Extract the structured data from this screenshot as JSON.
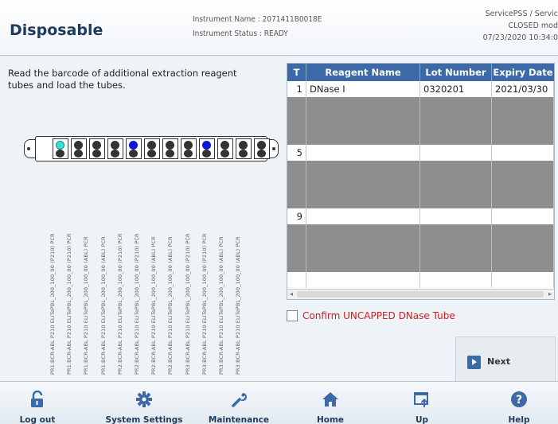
{
  "header": {
    "title": "Disposable",
    "instrument_name": "Instrument Name : 2071411B0018E",
    "instrument_status": "Instrument Status : READY",
    "user": "ServicePSS / Servic",
    "mode": "CLOSED mod",
    "datetime": "07/23/2020 10:34:0"
  },
  "instruction": "Read the barcode of additional extraction reagent tubes and load the tubes.",
  "rack": {
    "slots": [
      "cyan",
      "dark",
      "dark",
      "dark",
      "blue",
      "dark",
      "dark",
      "dark",
      "blue",
      "dark",
      "dark",
      "dark"
    ],
    "colors": {
      "cyan": "#34e2d5",
      "blue": "#0a17d6",
      "dark": "#333333"
    }
  },
  "tube_labels": [
    "PR1:BCR-ABL P210 ELITePBL_200_100_00 (P210) PCR",
    "PR1:BCR-ABL P210 ELITePBL_200_100_00 (P210) PCR",
    "PR1:BCR-ABL P210 ELITePBL_200_100_00 (ABL) PCR",
    "PR1:BCR-ABL P210 ELITePBL_200_100_00 (ABL) PCR",
    "PR2:BCR-ABL P210 ELITePBL_200_100_00 (P210) PCR",
    "PR2:BCR-ABL P210 ELITePBL_200_100_00 (P210) PCR",
    "PR2:BCR-ABL P210 ELITePBL_200_100_00 (ABL) PCR",
    "PR2:BCR-ABL P210 ELITePBL_200_100_00 (ABL) PCR",
    "PR3:BCR-ABL P210 ELITePBL_200_100_00 (P210) PCR",
    "PR3:BCR-ABL P210 ELITePBL_200_100_00 (P210) PCR",
    "PR3:BCR-ABL P210 ELITePBL_200_100_00 (ABL) PCR",
    "PR3:BCR-ABL P210 ELITePBL_200_100_00 (ABL) PCR"
  ],
  "table": {
    "columns": [
      "T",
      "Reagent Name",
      "Lot Number",
      "Expiry Date"
    ],
    "rows": [
      {
        "t": "1",
        "name": "DNase I",
        "lot": "0320201",
        "expiry": "2021/03/30",
        "style": "white"
      },
      {
        "t": "",
        "name": "",
        "lot": "",
        "expiry": "",
        "style": "gray"
      },
      {
        "t": "",
        "name": "",
        "lot": "",
        "expiry": "",
        "style": "gray"
      },
      {
        "t": "",
        "name": "",
        "lot": "",
        "expiry": "",
        "style": "gray"
      },
      {
        "t": "5",
        "name": "",
        "lot": "",
        "expiry": "",
        "style": "white"
      },
      {
        "t": "",
        "name": "",
        "lot": "",
        "expiry": "",
        "style": "gray"
      },
      {
        "t": "",
        "name": "",
        "lot": "",
        "expiry": "",
        "style": "gray"
      },
      {
        "t": "",
        "name": "",
        "lot": "",
        "expiry": "",
        "style": "gray"
      },
      {
        "t": "9",
        "name": "",
        "lot": "",
        "expiry": "",
        "style": "white"
      },
      {
        "t": "",
        "name": "",
        "lot": "",
        "expiry": "",
        "style": "gray"
      },
      {
        "t": "",
        "name": "",
        "lot": "",
        "expiry": "",
        "style": "gray"
      },
      {
        "t": "",
        "name": "",
        "lot": "",
        "expiry": "",
        "style": "gray"
      },
      {
        "t": "",
        "name": "",
        "lot": "",
        "expiry": "",
        "style": "white"
      }
    ]
  },
  "confirm_label": "Confirm UNCAPPED DNase Tube",
  "next_label": "Next",
  "footer": {
    "buttons": [
      {
        "label": "Log out",
        "icon": "lock-open-icon"
      },
      {
        "label": "System Settings",
        "icon": "gear-icon"
      },
      {
        "label": "Maintenance",
        "icon": "wrench-icon"
      },
      {
        "label": "Home",
        "icon": "home-icon"
      },
      {
        "label": "Up",
        "icon": "up-icon"
      },
      {
        "label": "Help",
        "icon": "help-icon"
      }
    ]
  },
  "accent_color": "#3b6aa6",
  "warning_color": "#d61c1c"
}
